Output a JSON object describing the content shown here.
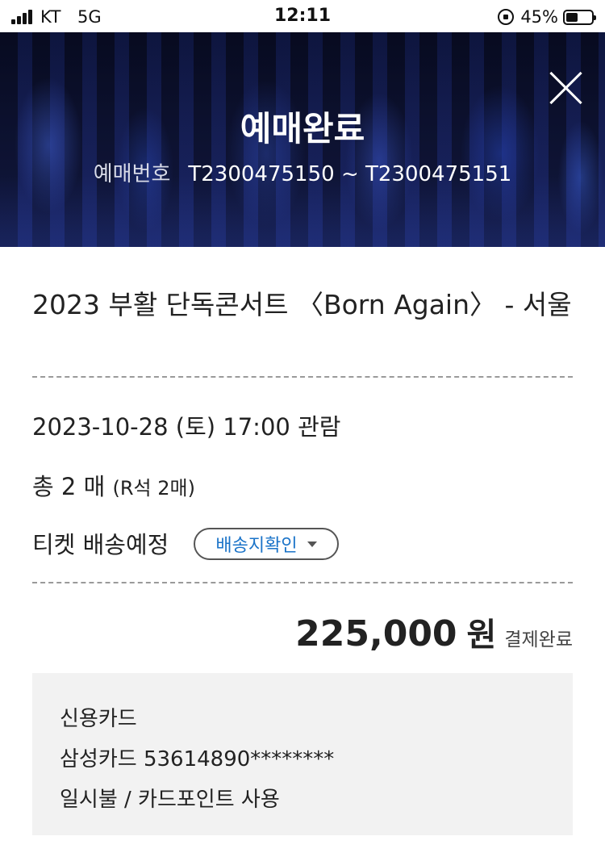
{
  "status_bar": {
    "carrier": "KT",
    "network": "5G",
    "time": "12:11",
    "battery_percent": "45%",
    "battery_level": 0.45
  },
  "header": {
    "title": "예매완료",
    "booking_label": "예매번호",
    "booking_numbers": "T2300475150 ~ T2300475151"
  },
  "event": {
    "title": "2023 부활 단독콘서트 〈Born Again〉 - 서울",
    "date_line": "2023-10-28 (토) 17:00 관람",
    "quantity_main": "총 2 매",
    "quantity_detail": "(R석 2매)",
    "delivery_label": "티켓 배송예정",
    "delivery_button": "배송지확인"
  },
  "payment": {
    "amount": "225,000",
    "unit": "원",
    "status": "결제완료",
    "method": "신용카드",
    "card": "삼성카드 53614890********",
    "installment": "일시불 / 카드포인트 사용"
  }
}
